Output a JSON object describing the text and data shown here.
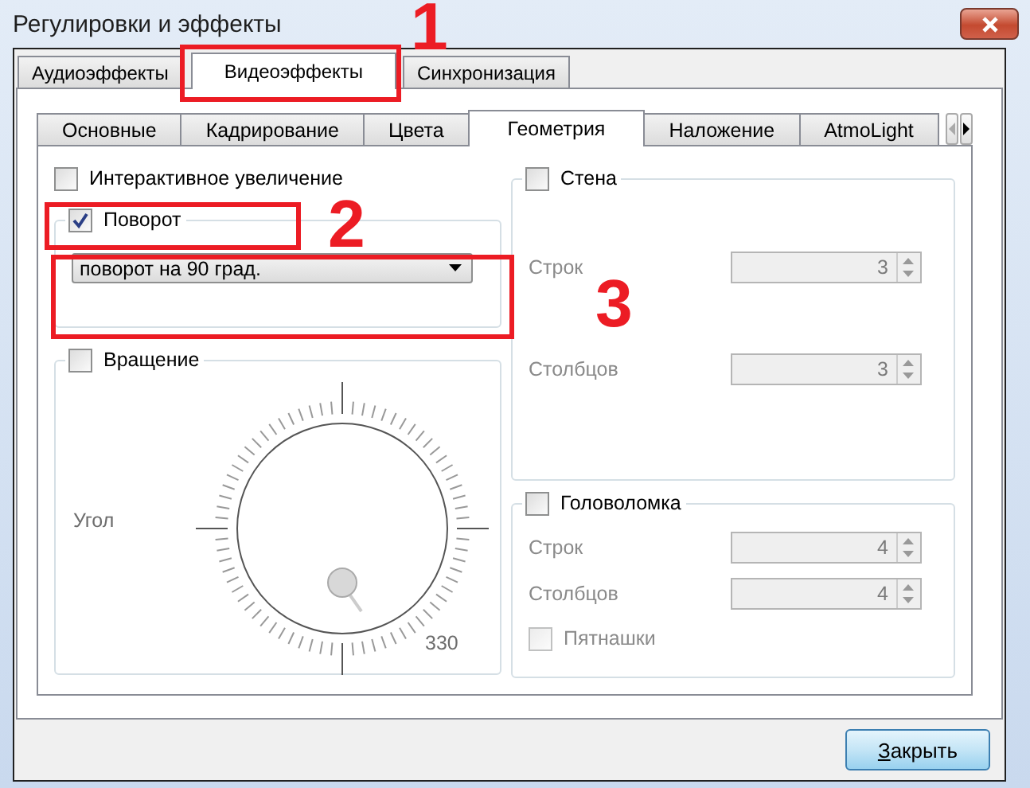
{
  "window": {
    "title": "Регулировки и эффекты"
  },
  "tabs": [
    {
      "label": "Аудиоэффекты",
      "selected": false
    },
    {
      "label": "Видеоэффекты",
      "selected": true
    },
    {
      "label": "Синхронизация",
      "selected": false
    }
  ],
  "subtabs": [
    {
      "label": "Основные",
      "selected": false
    },
    {
      "label": "Кадрирование",
      "selected": false
    },
    {
      "label": "Цвета",
      "selected": false
    },
    {
      "label": "Геометрия",
      "selected": true
    },
    {
      "label": "Наложение",
      "selected": false
    },
    {
      "label": "AtmoLight",
      "selected": false
    }
  ],
  "left": {
    "interactive_zoom": {
      "label": "Интерактивное увеличение",
      "checked": false
    },
    "rotate": {
      "label": "Поворот",
      "checked": true,
      "value": "поворот на 90 град."
    },
    "spin": {
      "label": "Вращение",
      "checked": false,
      "angle_label": "Угол",
      "reading": "330"
    }
  },
  "right": {
    "wall": {
      "label": "Стена",
      "checked": false,
      "fields": [
        {
          "label": "Строк",
          "value": "3"
        },
        {
          "label": "Столбцов",
          "value": "3"
        }
      ]
    },
    "puzzle": {
      "label": "Головоломка",
      "checked": false,
      "fields": [
        {
          "label": "Строк",
          "value": "4"
        },
        {
          "label": "Столбцов",
          "value": "4"
        }
      ],
      "shuffle": {
        "label": "Пятнашки",
        "checked": false
      }
    }
  },
  "footer": {
    "close_button": {
      "label": "Закрыть",
      "underline_first": true
    }
  },
  "annotations": [
    {
      "number": "1"
    },
    {
      "number": "2"
    },
    {
      "number": "3"
    }
  ]
}
